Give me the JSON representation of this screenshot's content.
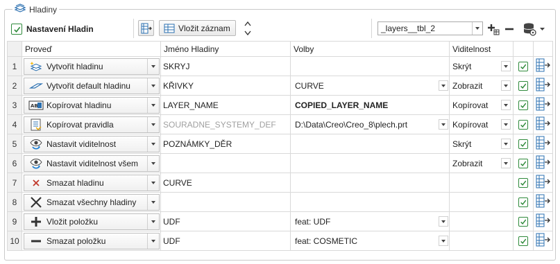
{
  "group": {
    "title": "Hladiny"
  },
  "toolbar": {
    "settings_label": "Nastavení Hladin",
    "insert_record_label": "Vložit záznam",
    "table_combo_value": "_layers__tbl_2"
  },
  "table": {
    "columns": [
      "Proveď",
      "Jméno Hladiny",
      "Volby",
      "Viditelnost"
    ],
    "rows": [
      {
        "num": "1",
        "action": "Vytvořit hladinu",
        "action_icon": "create-layer-icon",
        "name": "SKRYJ",
        "name_style": "",
        "option": "",
        "option_dropdown": false,
        "option_style": "",
        "visibility": "Skrýt",
        "visibility_dropdown": true,
        "checked": true
      },
      {
        "num": "2",
        "action": "Vytvořit default hladinu",
        "action_icon": "default-layer-icon",
        "name": "KŘIVKY",
        "name_style": "",
        "option": "CURVE",
        "option_dropdown": true,
        "option_style": "",
        "visibility": "Zobrazit",
        "visibility_dropdown": true,
        "checked": true
      },
      {
        "num": "3",
        "action": "Kopírovat hladinu",
        "action_icon": "copy-layer-icon",
        "name": "LAYER_NAME",
        "name_style": "",
        "option": "COPIED_LAYER_NAME",
        "option_dropdown": false,
        "option_style": "bold",
        "visibility": "Kopírovat",
        "visibility_dropdown": true,
        "checked": true
      },
      {
        "num": "4",
        "action": "Kopírovat pravidla",
        "action_icon": "copy-rules-icon",
        "name": "SOURADNE_SYSTEMY_DEF",
        "name_style": "muted",
        "option": "D:\\Data\\Creo\\Creo_8\\plech.prt",
        "option_dropdown": true,
        "option_style": "",
        "visibility": "Kopírovat",
        "visibility_dropdown": true,
        "checked": true
      },
      {
        "num": "5",
        "action": "Nastavit viditelnost",
        "action_icon": "visibility-icon",
        "name": "POZNÁMKY_DĚR",
        "name_style": "",
        "option": "",
        "option_dropdown": false,
        "option_style": "",
        "visibility": "Skrýt",
        "visibility_dropdown": true,
        "checked": true
      },
      {
        "num": "6",
        "action": "Nastavit viditelnost všem",
        "action_icon": "visibility-all-icon",
        "name": "",
        "name_style": "",
        "option": "",
        "option_dropdown": false,
        "option_style": "",
        "visibility": "Zobrazit",
        "visibility_dropdown": true,
        "checked": true
      },
      {
        "num": "7",
        "action": "Smazat hladinu",
        "action_icon": "delete-layer-icon",
        "name": "CURVE",
        "name_style": "",
        "option": "",
        "option_dropdown": false,
        "option_style": "",
        "visibility": "",
        "visibility_dropdown": false,
        "checked": true
      },
      {
        "num": "8",
        "action": "Smazat všechny hladiny",
        "action_icon": "delete-all-icon",
        "name": "",
        "name_style": "",
        "option": "",
        "option_dropdown": false,
        "option_style": "",
        "visibility": "",
        "visibility_dropdown": false,
        "checked": true
      },
      {
        "num": "9",
        "action": "Vložit položku",
        "action_icon": "plus-icon",
        "name": "UDF",
        "name_style": "",
        "option": "feat: UDF",
        "option_dropdown": true,
        "option_style": "",
        "visibility": "",
        "visibility_dropdown": false,
        "checked": true
      },
      {
        "num": "10",
        "action": "Smazat položku",
        "action_icon": "minus-icon",
        "name": "UDF",
        "name_style": "",
        "option": "feat: COSMETIC",
        "option_dropdown": true,
        "option_style": "",
        "visibility": "",
        "visibility_dropdown": false,
        "checked": true
      }
    ]
  },
  "colors": {
    "check_green": "#2f8a3b",
    "border": "#d9d9d9",
    "rownum_bg": "#f0f0f0"
  }
}
